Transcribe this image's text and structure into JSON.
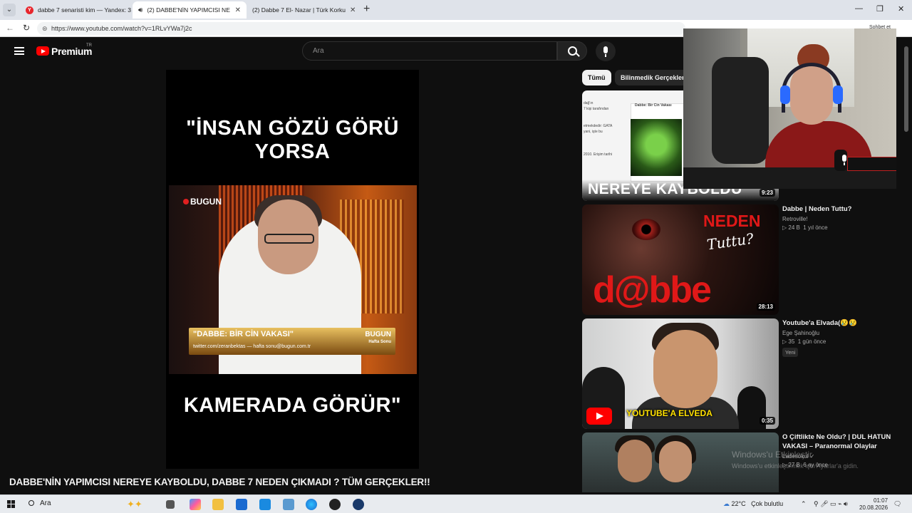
{
  "browser": {
    "tabs": [
      {
        "label": "dabbe 7 senaristi kim — Yandex: 3",
        "favicon": "yandex-icon"
      },
      {
        "label": "(2) DABBE'NİN YAPIMCISI NE",
        "favicon": "youtube-icon",
        "active": true
      },
      {
        "label": "(2) Dabbe 7 El- Nazar | Türk Korku",
        "favicon": "youtube-icon"
      }
    ],
    "url": "https://www.youtube.com/watch?v=1RLvYWa7j2c",
    "sohbet": "Sohbet et"
  },
  "youtube": {
    "logo_text": "Premium",
    "region": "TR",
    "search_placeholder": "Ara",
    "video": {
      "caption_top": "\"İNSAN GÖZÜ GÖRÜ YORSA",
      "caption_bottom": "KAMERADA GÖRÜR\"",
      "channel_bug": "BUGUN",
      "lower_third": "\"DABBE: BİR CİN VAKASI\"",
      "lower_third_sub": "twitter.com/zeranbektas — hafta sonu@bugun.com.tr",
      "lower_third_bug": "BUGUN",
      "lower_third_bug2": "Hafta Sonu",
      "title": "DABBE'NİN YAPIMCISI NEREYE KAYBOLDU, DABBE 7 NEDEN ÇIKMADI ? TÜM GERÇEKLER!!"
    },
    "chips": [
      "Tümü",
      "Bilinmedik Gerçekler"
    ],
    "recommendations": [
      {
        "thumb_text": "NEREYE KAYBOLDU",
        "thumb_doc_title": "Dabbe: Bir Cin Vakası",
        "duration": "9:23"
      },
      {
        "title": "Dabbe | Neden Tuttu?",
        "channel": "Retroville!",
        "views": "▷ 24 B",
        "age": "1 yıl önce",
        "thumb_word1": "NEDEN",
        "thumb_word2": "Tuttu?",
        "thumb_logo": "d@bbe",
        "duration": "28:13"
      },
      {
        "title": "Youtube'a Elvada(😢😢",
        "channel": "Ege Şahinoğlu",
        "views": "▷ 35",
        "age": "1 gün önce",
        "badge": "Yeni",
        "thumb_text": "YOUTUBE'A ELVEDA",
        "duration": "0:35"
      },
      {
        "title": "O Çiftlikte Ne Oldu? | DUL HATUN VAKASI – Paranormal Olaylar",
        "channel": "Ladesokul ✓",
        "views": "▷ 27 B",
        "age": "6 ay önce"
      }
    ],
    "watermark": {
      "line1": "Windows'u Etkinleştir",
      "line2": "Windows'u etkinleştirmek için Ayarlar'a gidin."
    }
  },
  "taskbar": {
    "search": "Ara",
    "weather": "22°C",
    "weather_desc": "Çok bulutlu",
    "time": "01:07",
    "date": "20.08.2026"
  },
  "colors": {
    "yt_red": "#ff0000",
    "yt_bg": "#0f0f0f",
    "text_primary": "#f1f1f1",
    "text_secondary": "#aaaaaa"
  }
}
